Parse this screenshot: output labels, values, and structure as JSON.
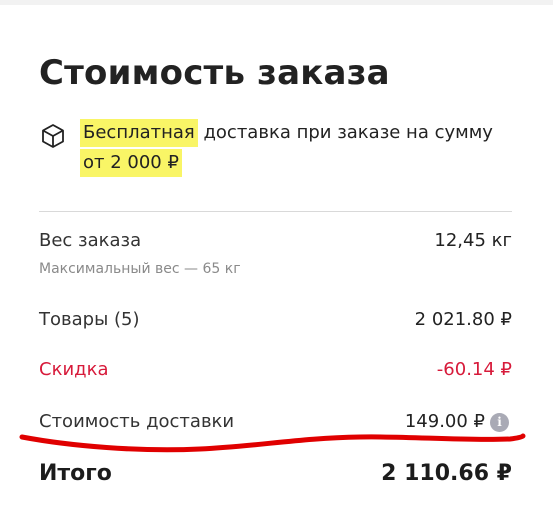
{
  "order_summary": {
    "title": "Стоимость заказа",
    "delivery_note": {
      "highlight_word": "Бесплатная",
      "text_middle": " доставка при заказе на сумму ",
      "highlight_amount": "от 2 000 ₽",
      "icon": "box-icon"
    },
    "weight": {
      "label": "Вес заказа",
      "value": "12,45 кг",
      "sublabel": "Максимальный вес — 65 кг"
    },
    "items": {
      "label": "Товары (5)",
      "value": "2 021.80 ₽"
    },
    "discount": {
      "label": "Скидка",
      "value": "-60.14 ₽",
      "color": "#d71a3a"
    },
    "delivery_cost": {
      "label": "Стоимость доставки",
      "value": "149.00 ₽",
      "info_icon": "info-icon",
      "info_glyph": "i"
    },
    "total": {
      "label": "Итого",
      "value": "2 110.66 ₽"
    }
  },
  "colors": {
    "highlight": "#f9f566",
    "annotation_stroke": "#e00000"
  }
}
